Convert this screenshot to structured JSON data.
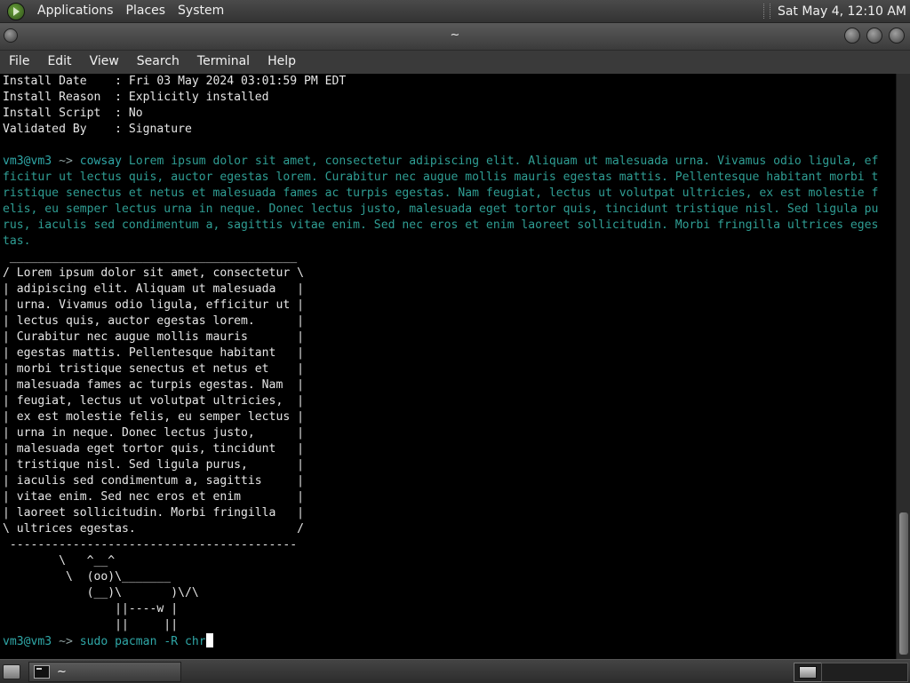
{
  "top_panel": {
    "menus": [
      "Applications",
      "Places",
      "System"
    ],
    "clock": "Sat May  4, 12:10 AM"
  },
  "window": {
    "title": "~",
    "menus": [
      "File",
      "Edit",
      "View",
      "Search",
      "Terminal",
      "Help"
    ]
  },
  "terminal": {
    "info_lines": [
      "Install Date    : Fri 03 May 2024 03:01:59 PM EDT",
      "Install Reason  : Explicitly installed",
      "Install Script  : No",
      "Validated By    : Signature"
    ],
    "prompt_user": "vm3@vm3",
    "prompt_arrow": " ~> ",
    "cowsay_command": "cowsay",
    "cowsay_wrapped": [
      " Lorem ipsum dolor sit amet, consectetur adipiscing elit. Aliquam ut malesuada urna. Vivamus odio ligula, ef",
      "ficitur ut lectus quis, auctor egestas lorem. Curabitur nec augue mollis mauris egestas mattis. Pellentesque habitant morbi t",
      "ristique senectus et netus et malesuada fames ac turpis egestas. Nam feugiat, lectus ut volutpat ultricies, ex est molestie f",
      "elis, eu semper lectus urna in neque. Donec lectus justo, malesuada eget tortor quis, tincidunt tristique nisl. Sed ligula pu",
      "rus, iaculis sed condimentum a, sagittis vitae enim. Sed nec eros et enim laoreet sollicitudin. Morbi fringilla ultrices eges",
      "tas."
    ],
    "cow_bubble": [
      " _________________________________________",
      "/ Lorem ipsum dolor sit amet, consectetur \\",
      "| adipiscing elit. Aliquam ut malesuada   |",
      "| urna. Vivamus odio ligula, efficitur ut |",
      "| lectus quis, auctor egestas lorem.      |",
      "| Curabitur nec augue mollis mauris       |",
      "| egestas mattis. Pellentesque habitant   |",
      "| morbi tristique senectus et netus et    |",
      "| malesuada fames ac turpis egestas. Nam  |",
      "| feugiat, lectus ut volutpat ultricies,  |",
      "| ex est molestie felis, eu semper lectus |",
      "| urna in neque. Donec lectus justo,      |",
      "| malesuada eget tortor quis, tincidunt   |",
      "| tristique nisl. Sed ligula purus,       |",
      "| iaculis sed condimentum a, sagittis     |",
      "| vitae enim. Sed nec eros et enim        |",
      "| laoreet sollicitudin. Morbi fringilla   |",
      "\\ ultrices egestas.                       /",
      " -----------------------------------------",
      "        \\   ^__^",
      "         \\  (oo)\\_______",
      "            (__)\\       )\\/\\",
      "                ||----w |",
      "                ||     ||"
    ],
    "current_command": "sudo pacman -R chr"
  },
  "bottom_panel": {
    "task_title": "~"
  },
  "colors": {
    "prompt": "#2fa7a7",
    "command_text": "#2f9e94",
    "terminal_bg": "#000000",
    "terminal_fg": "#e6e6e6"
  }
}
